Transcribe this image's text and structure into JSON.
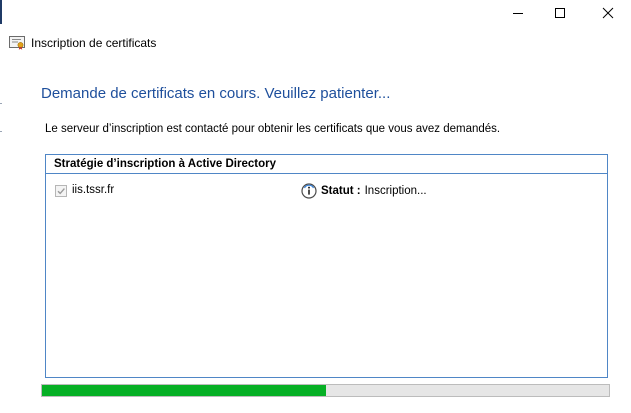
{
  "window": {
    "app_title": "Inscription de certificats",
    "icons": {
      "app": "certificate-icon",
      "minimize": "minimize-icon",
      "maximize": "maximize-icon",
      "close": "close-icon"
    }
  },
  "main": {
    "heading": "Demande de certificats en cours. Veuillez patienter...",
    "description": "Le serveur d’inscription est contacté pour obtenir les certificats que vous avez demandés."
  },
  "policy": {
    "title": "Stratégie d’inscription à Active Directory",
    "items": [
      {
        "name": "iis.tssr.fr",
        "checked": true,
        "status_label": "Statut :",
        "status_value": "Inscription...",
        "status_icon": "info-icon"
      }
    ]
  },
  "progress": {
    "percent": 50
  },
  "colors": {
    "heading": "#1e4f9c",
    "border": "#4f86c6",
    "progress": "#06b025"
  }
}
